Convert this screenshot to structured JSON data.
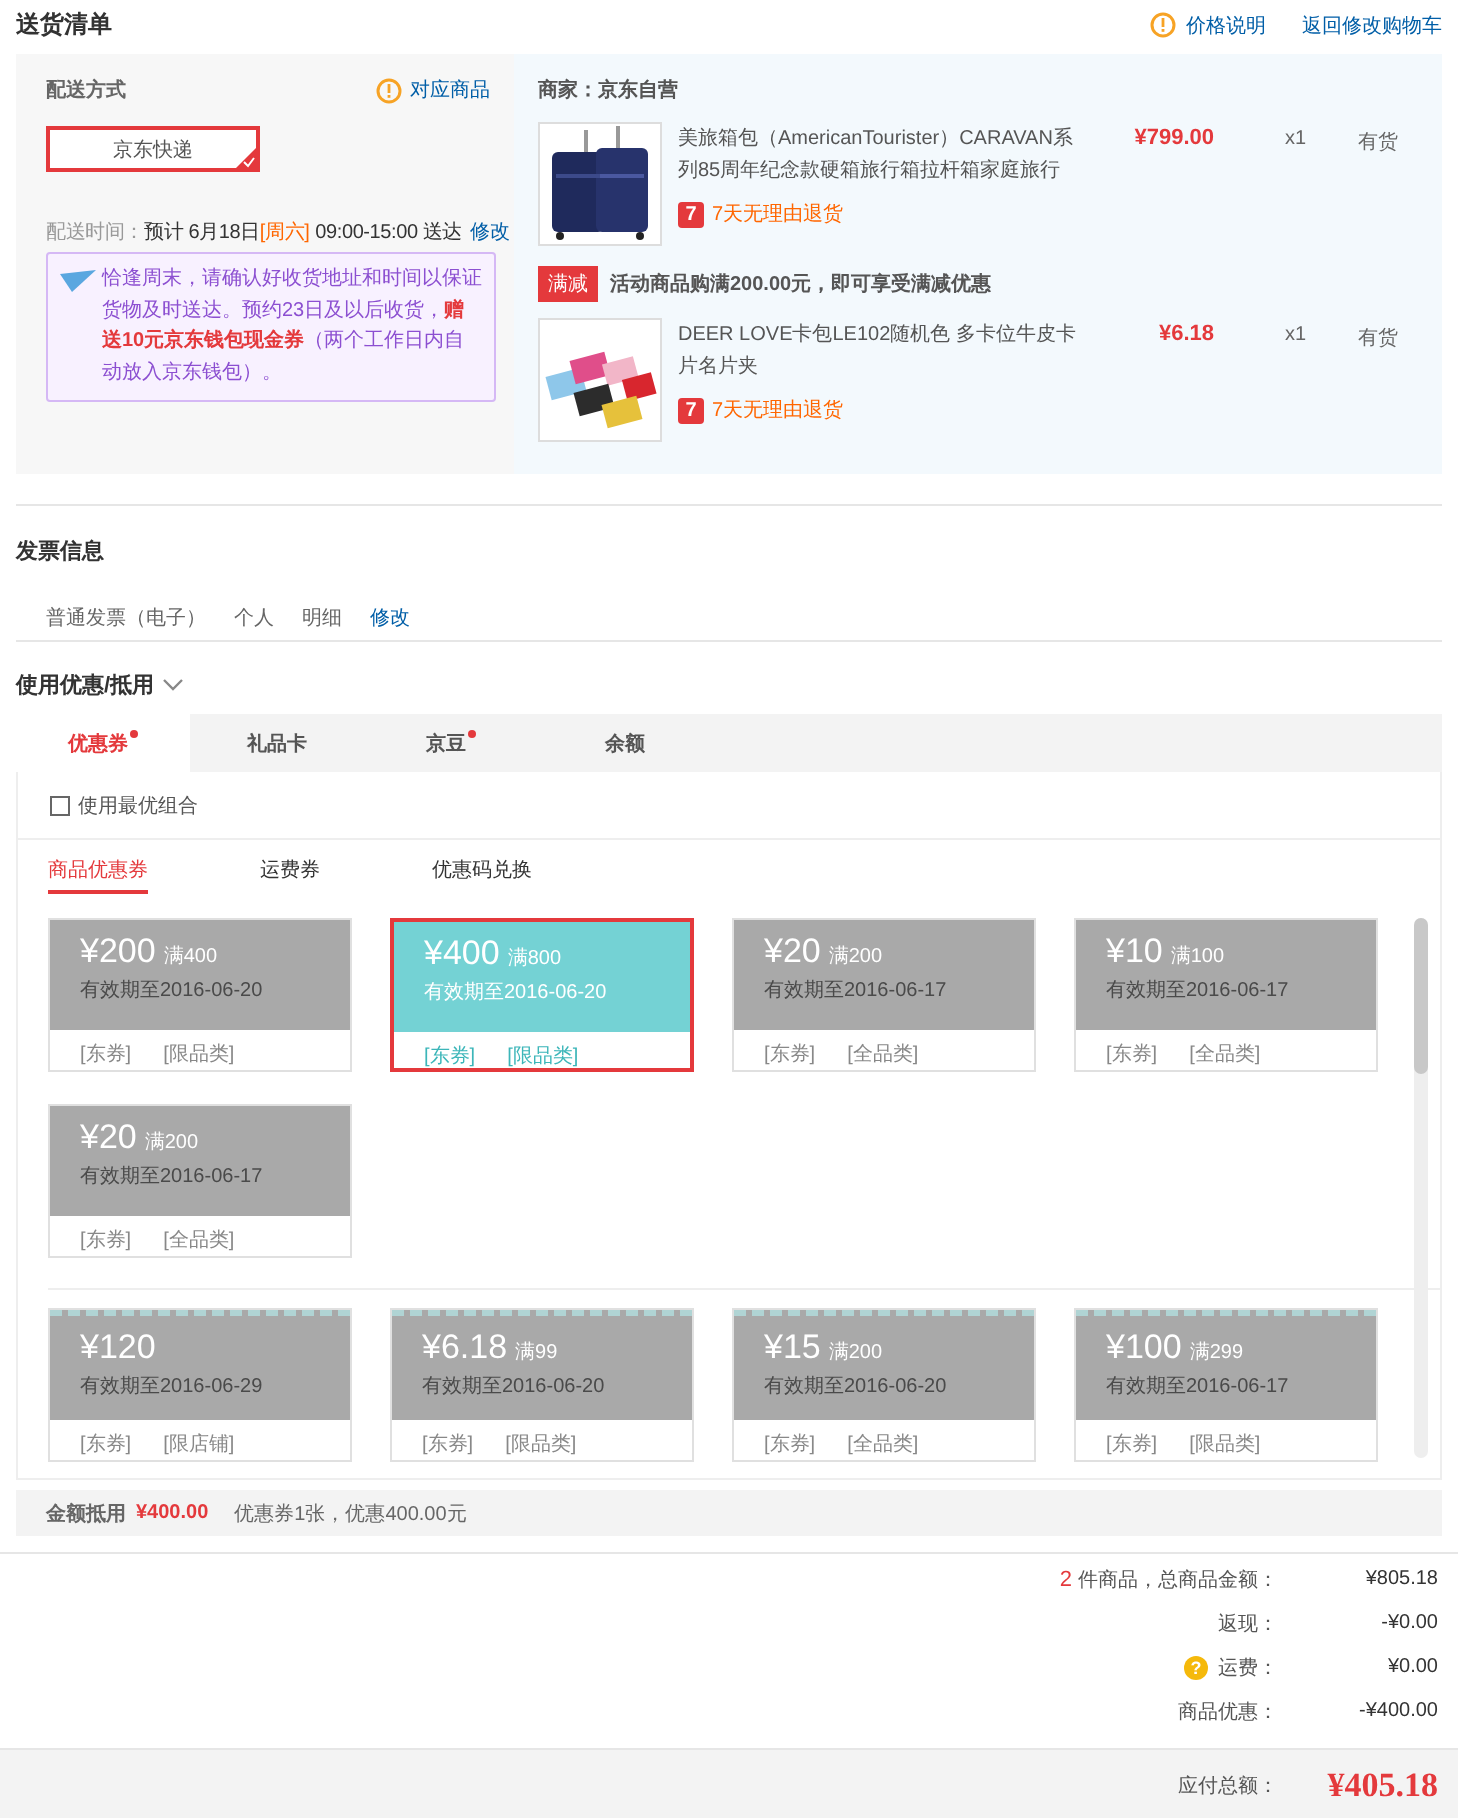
{
  "header": {
    "title": "送货清单",
    "links": [
      {
        "label": "价格说明",
        "kind": "info"
      },
      {
        "label": "返回修改购物车",
        "kind": "plain"
      }
    ]
  },
  "delivery": {
    "label": "配送方式",
    "goods_link": "对应商品",
    "method": {
      "label": "京东快递",
      "selected": true
    },
    "time_label": "配送时间：",
    "time_date": "预计 6月18日",
    "weekday": "[周六]",
    "time_window": "09:00-15:00 送达",
    "edit": "修改",
    "notice": "恰逢周末，请确认好收货地址和时间以保证货物及时送达。预约23日及以后收货，**赠送10元京东钱包现金券**（两个工作日内自动放入京东钱包）。"
  },
  "shop": {
    "label": "商家：京东自营",
    "items": [
      {
        "name": "美旅箱包（AmericanTourister）CARAVAN系列85周年纪念款硬箱旅行箱拉杆箱家庭旅行",
        "price": "¥799.00",
        "qty": "x1",
        "stock": "有货",
        "return_badge": "7",
        "return_policy": "7天无理由退货"
      },
      {
        "promo": {
          "badge": "满减",
          "text": "活动商品购满200.00元，即可享受满减优惠"
        },
        "name": "DEER LOVE卡包LE102随机色 多卡位牛皮卡片名片夹",
        "price": "¥6.18",
        "qty": "x1",
        "stock": "有货",
        "return_badge": "7",
        "return_policy": "7天无理由退货"
      }
    ]
  },
  "invoice": {
    "title": "发票信息",
    "fields": [
      "普通发票（电子）",
      "个人",
      "明细"
    ],
    "edit": "修改"
  },
  "discounts": {
    "title": "使用优惠/抵用",
    "tabs": [
      {
        "label": "优惠券",
        "selected": true,
        "dot": true
      },
      {
        "label": "礼品卡",
        "selected": false,
        "dot": false
      },
      {
        "label": "京豆",
        "selected": false,
        "dot": true
      },
      {
        "label": "余额",
        "selected": false,
        "dot": false
      }
    ],
    "best_combo": {
      "label": "使用最优组合",
      "checked": false
    },
    "subtabs": [
      {
        "label": "商品优惠券",
        "selected": true
      },
      {
        "label": "运费券",
        "selected": false
      },
      {
        "label": "优惠码兑换",
        "selected": false
      }
    ],
    "coupon_groups": [
      {
        "kind": "plain",
        "coupons": [
          {
            "amount": "¥200",
            "condition": "满400",
            "expiry": "有效期至2016-06-20",
            "tags": [
              "[东券]",
              "[限品类]"
            ],
            "selected": false
          },
          {
            "amount": "¥400",
            "condition": "满800",
            "expiry": "有效期至2016-06-20",
            "tags": [
              "[东券]",
              "[限品类]"
            ],
            "selected": true
          },
          {
            "amount": "¥20",
            "condition": "满200",
            "expiry": "有效期至2016-06-17",
            "tags": [
              "[东券]",
              "[全品类]"
            ],
            "selected": false
          },
          {
            "amount": "¥10",
            "condition": "满100",
            "expiry": "有效期至2016-06-17",
            "tags": [
              "[东券]",
              "[全品类]"
            ],
            "selected": false
          },
          {
            "amount": "¥20",
            "condition": "满200",
            "expiry": "有效期至2016-06-17",
            "tags": [
              "[东券]",
              "[全品类]"
            ],
            "selected": false
          }
        ]
      },
      {
        "kind": "perforated",
        "coupons": [
          {
            "amount": "¥120",
            "expiry": "有效期至2016-06-29",
            "tags": [
              "[东券]",
              "[限店铺]"
            ],
            "selected": false
          },
          {
            "amount": "¥6.18",
            "condition": "满99",
            "expiry": "有效期至2016-06-20",
            "tags": [
              "[东券]",
              "[限品类]"
            ],
            "selected": false
          },
          {
            "amount": "¥15",
            "condition": "满200",
            "expiry": "有效期至2016-06-20",
            "tags": [
              "[东券]",
              "[全品类]"
            ],
            "selected": false
          },
          {
            "amount": "¥100",
            "condition": "满299",
            "expiry": "有效期至2016-06-17",
            "tags": [
              "[东券]",
              "[限品类]"
            ],
            "selected": false
          }
        ]
      }
    ],
    "summary": {
      "label": "金额抵用",
      "amount": "¥400.00",
      "detail": "优惠券1张，优惠400.00元"
    }
  },
  "totals": {
    "rows": [
      {
        "count": "2",
        "label": "件商品，总商品金额：",
        "value": "¥805.18"
      },
      {
        "label": "返现：",
        "value": "-¥0.00"
      },
      {
        "help": "?",
        "label": "运费：",
        "value": "¥0.00"
      },
      {
        "label": "商品优惠：",
        "value": "-¥400.00"
      }
    ],
    "payable": {
      "label": "应付总额：",
      "value": "¥405.18"
    }
  }
}
